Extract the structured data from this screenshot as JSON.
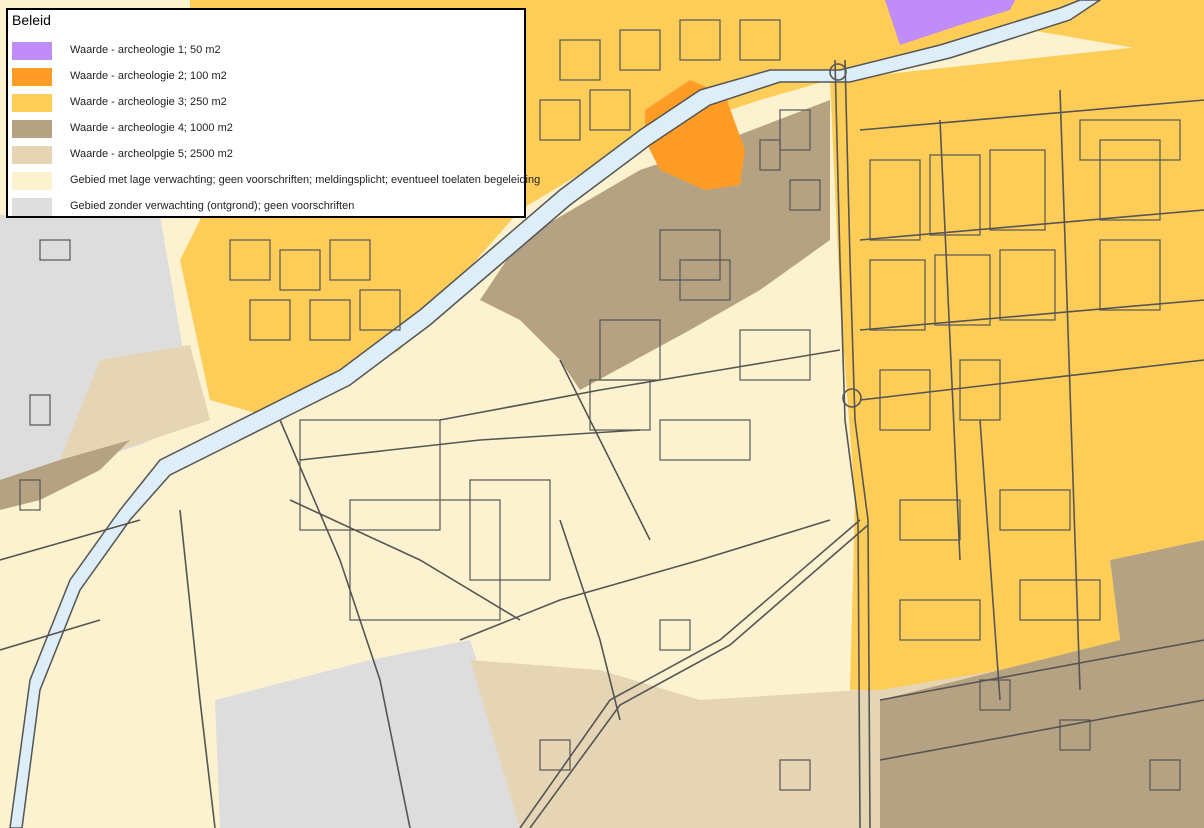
{
  "legend": {
    "title": "Beleid",
    "items": [
      {
        "label": "Waarde - archeologie 1; 50 m2",
        "color": "#c08cf7"
      },
      {
        "label": "Waarde - archeologie 2; 100 m2",
        "color": "#fe9c25"
      },
      {
        "label": "Waarde - archeologie 3; 250 m2",
        "color": "#fecd58"
      },
      {
        "label": "Waarde - archeologie 4; 1000 m2",
        "color": "#b5a282"
      },
      {
        "label": "Waarde - archeolpgie 5; 2500 m2",
        "color": "#e6d5b5"
      },
      {
        "label": "Gebied met lage verwachting; geen voorschriften; meldingsplicht; eventueel toelaten begeleiding",
        "color": "#fdf2cf"
      },
      {
        "label": "Gebied zonder verwachting (ontgrond); geen voorschriften",
        "color": "#dddddd"
      }
    ]
  },
  "map": {
    "colors": {
      "archeologie_1": "#c08cf7",
      "archeologie_2": "#fe9c25",
      "archeologie_3": "#fecd58",
      "archeologie_4": "#b5a282",
      "archeologie_5": "#e6d5b5",
      "lage_verwachting": "#fdf2cf",
      "zonder_verwachting": "#dddddd",
      "water": "#ddeef9",
      "lines": "#555555"
    }
  }
}
